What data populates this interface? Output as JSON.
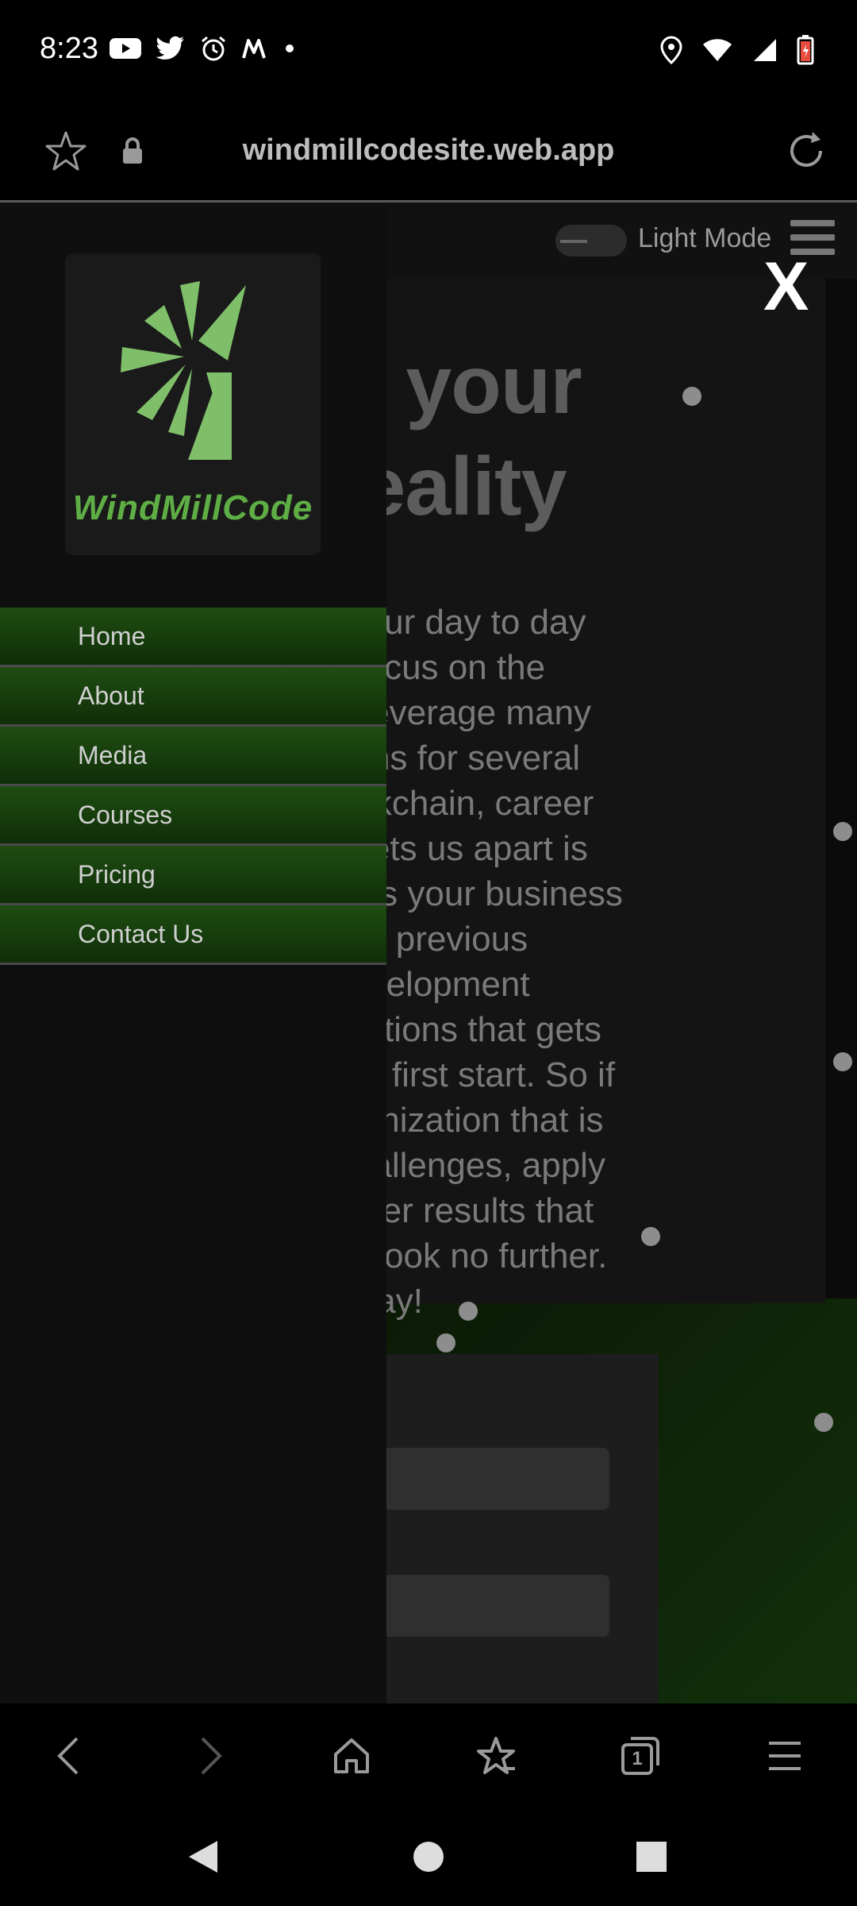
{
  "status_bar": {
    "time": "8:23",
    "left_icons": [
      "youtube-icon",
      "twitter-icon",
      "alarm-icon",
      "m-app-icon",
      "dot-icon"
    ],
    "right_icons": [
      "location-icon",
      "wifi-icon",
      "signal-icon",
      "battery-icon"
    ]
  },
  "url_bar": {
    "url": "windmillcodesite.web.app"
  },
  "header": {
    "light_mode_label": "Light Mode"
  },
  "close_label": "X",
  "drawer": {
    "logo_text": "WindMillCode",
    "menu": [
      {
        "label": "Home"
      },
      {
        "label": "About"
      },
      {
        "label": "Media"
      },
      {
        "label": "Courses"
      },
      {
        "label": "Pricing"
      },
      {
        "label": "Contact Us"
      }
    ]
  },
  "hero": {
    "title_line1": "orm your",
    "title_line2": "to reality",
    "text_lines": [
      "Code, our day to day",
      "vith a focus on the",
      "d. We leverage many",
      "plications for several",
      "ng blockchain, career",
      "What sets us apart is",
      "y assess your business",
      "pply our previous",
      "and development",
      "ver solutions that gets",
      "a viable first start. So if",
      "an organization that is",
      "new challenges, apply",
      "nd deliver results that",
      "s, then look no further.",
      "t us today!"
    ]
  },
  "browser_toolbar": [
    "back-icon",
    "forward-icon",
    "home-icon",
    "bookmarks-icon",
    "tabs-icon",
    "menu-icon"
  ],
  "tabs_count": "1",
  "colors": {
    "menu_green": "#1f4d12",
    "logo_green": "#5fae45",
    "background": "#0b0b0b"
  }
}
